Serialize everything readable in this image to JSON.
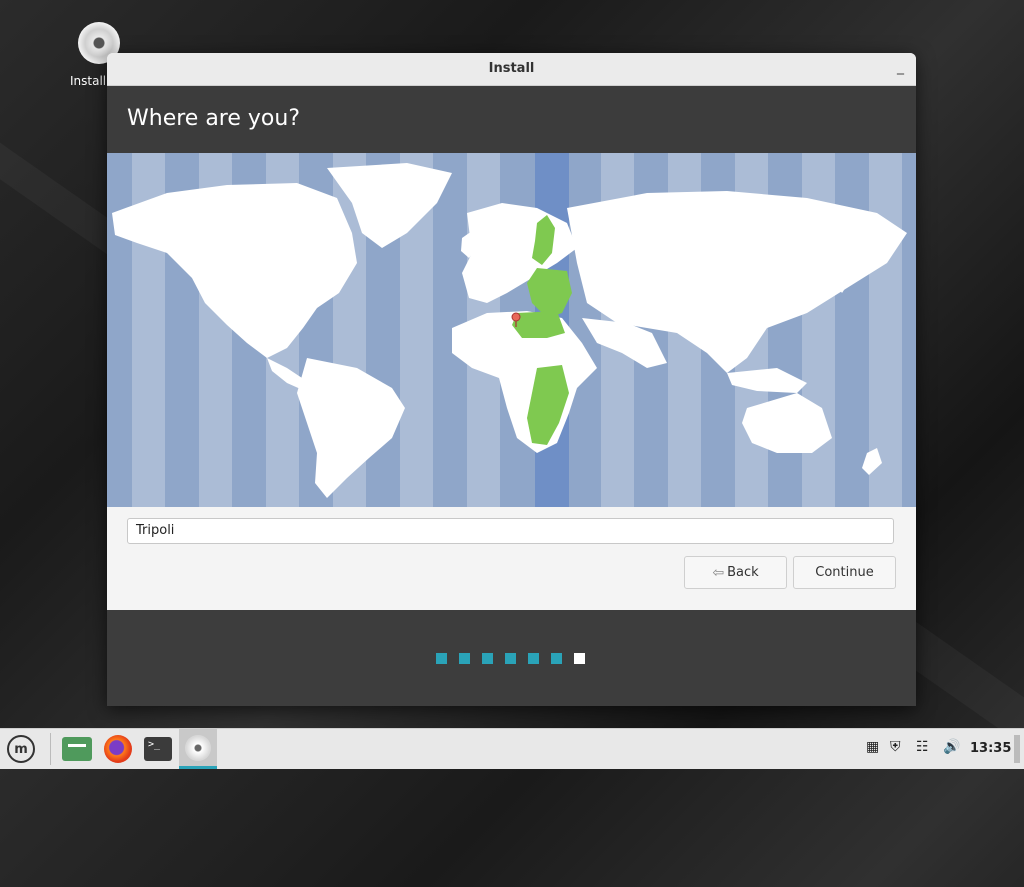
{
  "desktop": {
    "icon_label": "Install"
  },
  "window": {
    "title": "Install",
    "minimize": "_"
  },
  "page": {
    "heading": "Where are you?"
  },
  "location": {
    "value": "Tripoli"
  },
  "buttons": {
    "back": "Back",
    "continue": "Continue"
  },
  "progress": {
    "total_steps": 7,
    "current_step": 7
  },
  "taskbar": {
    "clock": "13:35"
  },
  "colors": {
    "accent": "#2aa3b8",
    "ocean": "#8fa6c9",
    "land": "#ffffff",
    "highlight_zone": "#7fc950",
    "header": "#3c3c3c"
  }
}
